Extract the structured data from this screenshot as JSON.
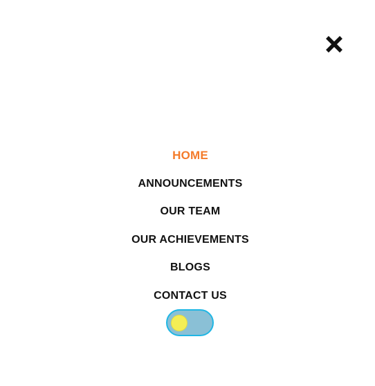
{
  "menu": {
    "close_icon": "close-icon",
    "items": [
      {
        "label": "HOME",
        "active": true
      },
      {
        "label": "ANNOUNCEMENTS",
        "active": false
      },
      {
        "label": "OUR TEAM",
        "active": false
      },
      {
        "label": "OUR ACHIEVEMENTS",
        "active": false
      },
      {
        "label": "BLOGS",
        "active": false
      },
      {
        "label": "CONTACT US",
        "active": false
      }
    ],
    "theme_toggle": {
      "icon": "sun-icon",
      "state": "light"
    }
  },
  "colors": {
    "active": "#f47b2a",
    "text": "#111111",
    "toggle_track": "#8ac0d6",
    "toggle_border": "#1fb6e4",
    "toggle_knob": "#f4ee55"
  }
}
